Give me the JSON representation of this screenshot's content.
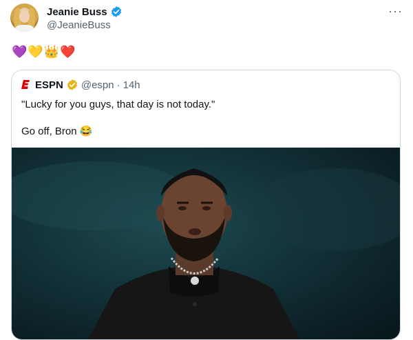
{
  "tweet": {
    "display_name": "Jeanie Buss",
    "handle": "@JeanieBuss",
    "more_label": "···",
    "emojis": [
      "💜",
      "💛",
      "👑",
      "❤️"
    ]
  },
  "quoted": {
    "name": "ESPN",
    "handle": "@espn",
    "separator": "·",
    "time": "14h",
    "line1": "\"Lucky for you guys, that day is not today.\"",
    "line2": "Go off, Bron 😂"
  },
  "colors": {
    "verified_blue": "#1d9bf0",
    "verified_gold": "#e2b719",
    "espn_red": "#d00",
    "secondary_text": "#536471"
  }
}
